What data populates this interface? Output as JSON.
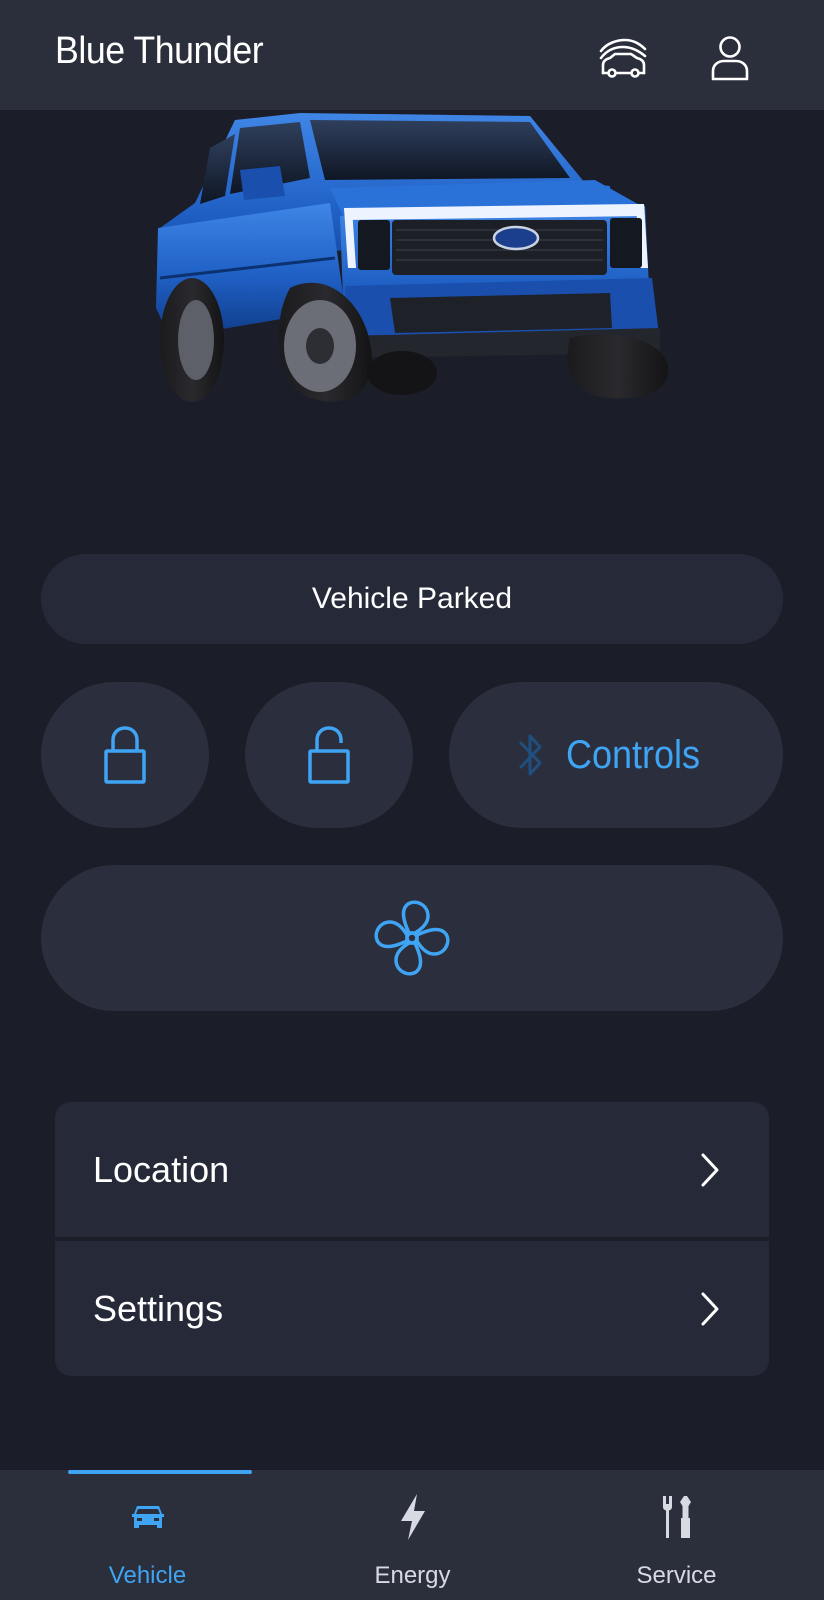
{
  "header": {
    "title": "Blue Thunder",
    "garage_icon": "vehicle-garage-icon",
    "profile_icon": "user-profile-icon"
  },
  "vehicle": {
    "status": "Vehicle Parked"
  },
  "controls": {
    "lock_icon": "lock-icon",
    "unlock_icon": "unlock-icon",
    "controls_label": "Controls",
    "bluetooth_icon": "bluetooth-icon",
    "climate_icon": "fan-icon"
  },
  "menu": {
    "items": [
      {
        "label": "Location",
        "icon": "chevron-right-icon"
      },
      {
        "label": "Settings",
        "icon": "chevron-right-icon"
      }
    ]
  },
  "bottom_nav": {
    "items": [
      {
        "label": "Vehicle",
        "icon": "car-icon",
        "active": true
      },
      {
        "label": "Energy",
        "icon": "lightning-icon",
        "active": false
      },
      {
        "label": "Service",
        "icon": "tools-icon",
        "active": false
      }
    ]
  },
  "colors": {
    "background": "#1b1e29",
    "surface": "#2b2e3c",
    "card": "#262937",
    "accent": "#3fa4f4",
    "text": "#ffffff",
    "vehicle_paint": "#1f5fc4"
  }
}
